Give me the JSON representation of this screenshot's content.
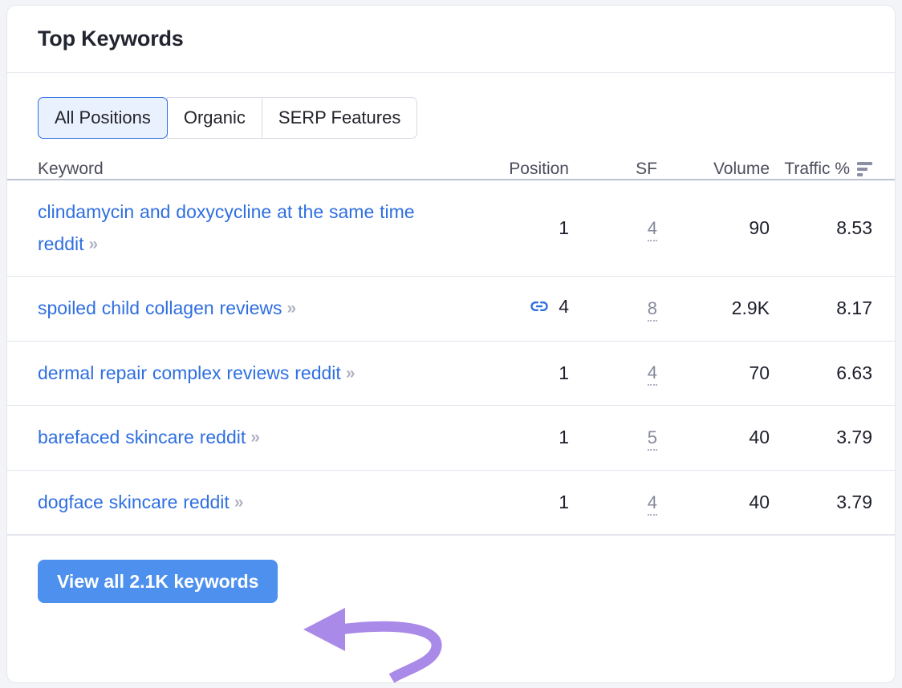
{
  "card": {
    "title": "Top Keywords"
  },
  "tabs": [
    {
      "label": "All Positions",
      "active": true
    },
    {
      "label": "Organic",
      "active": false
    },
    {
      "label": "SERP Features",
      "active": false
    }
  ],
  "table": {
    "headers": {
      "keyword": "Keyword",
      "position": "Position",
      "sf": "SF",
      "volume": "Volume",
      "traffic": "Traffic %"
    },
    "sort": {
      "column": "Traffic %",
      "direction": "descending",
      "icon": "sort-descending-icon"
    },
    "rows": [
      {
        "keyword": "clindamycin and doxycycline at the same time reddit",
        "keyword_icon": "double-chevron-right-icon",
        "position": "1",
        "position_icon": null,
        "sf": "4",
        "volume": "90",
        "traffic": "8.53"
      },
      {
        "keyword": "spoiled child collagen reviews",
        "keyword_icon": "double-chevron-right-icon",
        "position": "4",
        "position_icon": "link-icon",
        "sf": "8",
        "volume": "2.9K",
        "traffic": "8.17"
      },
      {
        "keyword": "dermal repair complex reviews reddit",
        "keyword_icon": "double-chevron-right-icon",
        "position": "1",
        "position_icon": null,
        "sf": "4",
        "volume": "70",
        "traffic": "6.63"
      },
      {
        "keyword": "barefaced skincare reddit",
        "keyword_icon": "double-chevron-right-icon",
        "position": "1",
        "position_icon": null,
        "sf": "5",
        "volume": "40",
        "traffic": "3.79"
      },
      {
        "keyword": "dogface skincare reddit",
        "keyword_icon": "double-chevron-right-icon",
        "position": "1",
        "position_icon": null,
        "sf": "4",
        "volume": "40",
        "traffic": "3.79"
      }
    ]
  },
  "footer": {
    "view_all_label": "View all 2.1K keywords"
  },
  "annotation": {
    "name": "curved-arrow-pointing-to-view-all-button",
    "color": "#a98ae8"
  },
  "colors": {
    "accent_blue": "#2f6fe0",
    "button_blue": "#4d90ee",
    "active_tab_bg": "#eaf1fe",
    "page_bg": "#f3f4f7",
    "annotation_purple": "#a98ae8",
    "muted_text": "#85899b"
  }
}
